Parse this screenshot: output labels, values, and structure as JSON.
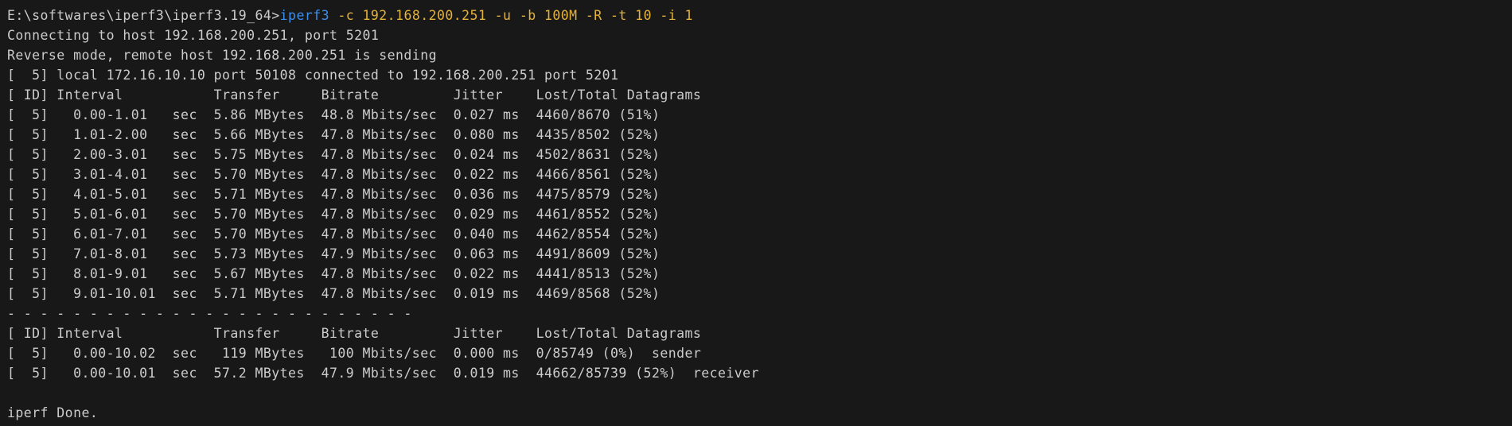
{
  "colors": {
    "background": "#181818",
    "text": "#cccccc",
    "command": "#3b8eea",
    "arguments": "#e5b23a"
  },
  "command": {
    "prompt": "E:\\softwares\\iperf3\\iperf3.19_64>",
    "name": "iperf3",
    "args": " -c 192.168.200.251 -u -b 100M -R -t 10 -i 1"
  },
  "lines": [
    "Connecting to host 192.168.200.251, port 5201",
    "Reverse mode, remote host 192.168.200.251 is sending",
    "[  5] local 172.16.10.10 port 50108 connected to 192.168.200.251 port 5201",
    "[ ID] Interval           Transfer     Bitrate         Jitter    Lost/Total Datagrams",
    "[  5]   0.00-1.01   sec  5.86 MBytes  48.8 Mbits/sec  0.027 ms  4460/8670 (51%)",
    "[  5]   1.01-2.00   sec  5.66 MBytes  47.8 Mbits/sec  0.080 ms  4435/8502 (52%)",
    "[  5]   2.00-3.01   sec  5.75 MBytes  47.8 Mbits/sec  0.024 ms  4502/8631 (52%)",
    "[  5]   3.01-4.01   sec  5.70 MBytes  47.8 Mbits/sec  0.022 ms  4466/8561 (52%)",
    "[  5]   4.01-5.01   sec  5.71 MBytes  47.8 Mbits/sec  0.036 ms  4475/8579 (52%)",
    "[  5]   5.01-6.01   sec  5.70 MBytes  47.8 Mbits/sec  0.029 ms  4461/8552 (52%)",
    "[  5]   6.01-7.01   sec  5.70 MBytes  47.8 Mbits/sec  0.040 ms  4462/8554 (52%)",
    "[  5]   7.01-8.01   sec  5.73 MBytes  47.9 Mbits/sec  0.063 ms  4491/8609 (52%)",
    "[  5]   8.01-9.01   sec  5.67 MBytes  47.8 Mbits/sec  0.022 ms  4441/8513 (52%)",
    "[  5]   9.01-10.01  sec  5.71 MBytes  47.8 Mbits/sec  0.019 ms  4469/8568 (52%)",
    "- - - - - - - - - - - - - - - - - - - - - - - - -",
    "[ ID] Interval           Transfer     Bitrate         Jitter    Lost/Total Datagrams",
    "[  5]   0.00-10.02  sec   119 MBytes   100 Mbits/sec  0.000 ms  0/85749 (0%)  sender",
    "[  5]   0.00-10.01  sec  57.2 MBytes  47.9 Mbits/sec  0.019 ms  44662/85739 (52%)  receiver",
    "",
    "iperf Done."
  ]
}
